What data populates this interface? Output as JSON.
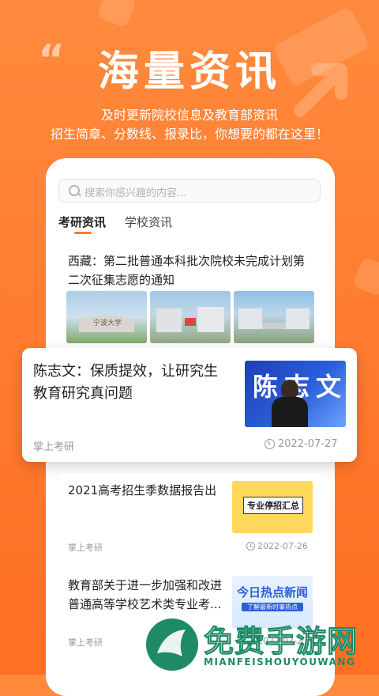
{
  "hero": {
    "quote_mark": "“",
    "title": "海量资讯",
    "subtitle_line1": "及时更新院校信息及教育部资讯",
    "subtitle_line2": "招生简章、分数线、报录比，你想要的都在这里！"
  },
  "search": {
    "placeholder": "搜索你感兴趣的内容..."
  },
  "tabs": [
    {
      "label": "考研资讯",
      "active": true
    },
    {
      "label": "学校资讯",
      "active": false
    }
  ],
  "articles": [
    {
      "title_line1": "西藏：第二批普通本科批次院校未完成计划第",
      "title_line2": "二次征集志愿的通知",
      "images": [
        "campus-gate",
        "campus-aerial-1",
        "campus-aerial-2"
      ],
      "thumb_text": "宁波大学"
    },
    {
      "title_line1": "陈志文：保质提效，让研究生",
      "title_line2": "教育研究真问题",
      "source": "掌上考研",
      "date": "2022-07-27",
      "thumb_text": "陈志文"
    },
    {
      "title_line1": "2021高考招生季数据报告出",
      "source": "掌上考研",
      "date": "2022-07-26",
      "thumb_text": "专业停招汇总"
    },
    {
      "title_line1": "教育部关于进一步加强和改进",
      "title_line2": "普通高等学校艺术类专业考...",
      "source": "掌上考研",
      "date": "2022-07-2",
      "thumb_text": "今日热点新闻",
      "thumb_subtext": "了解最新时事热点"
    }
  ],
  "watermark": {
    "title": "免费手游网",
    "subtitle": "MIANFEISHOUYOUWANG"
  },
  "colors": {
    "accent": "#ff7a2e",
    "watermark": "#1e8a66",
    "blue_thumb": "#2b5fd9"
  }
}
